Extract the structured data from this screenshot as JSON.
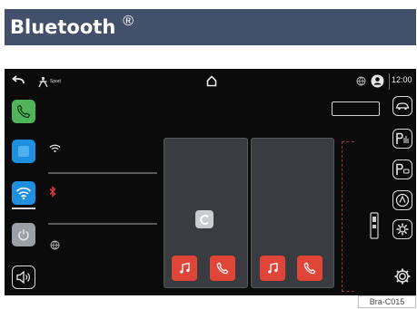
{
  "heading": {
    "title": "Bluetooth",
    "registered_mark": "®"
  },
  "status_bar": {
    "mode_label": "Sport",
    "time": "12:00"
  },
  "figure_ref": "Bra-C015",
  "colors": {
    "header_band": "#43506b",
    "phone_tile": "#4fb35a",
    "bluetooth_tile": "#1f8fe0",
    "wifi_tile": "#1f8fe0",
    "media_button": "#e0453a",
    "dashed_frame": "#a73131",
    "bluetooth_symbol": "#e03a3a"
  },
  "icons": {
    "top_bar": [
      "back-arrow-icon",
      "sport-mode-icon",
      "home-icon",
      "globe-icon",
      "profile-icon"
    ],
    "left_column": [
      "phone-icon",
      "bluetooth-square-icon",
      "wifi-icon",
      "power-icon",
      "volume-icon"
    ],
    "indicators": [
      "wifi-signal-icon",
      "bluetooth-icon",
      "globe-icon"
    ],
    "cards": [
      "car-icon",
      "music-icon",
      "phone-call-icon"
    ],
    "right_column": [
      "car-view-icon",
      "parking-assist-icon",
      "parking-camera-icon",
      "drive-assist-icon",
      "settings-gear-icon",
      "settings-cog-icon"
    ]
  }
}
